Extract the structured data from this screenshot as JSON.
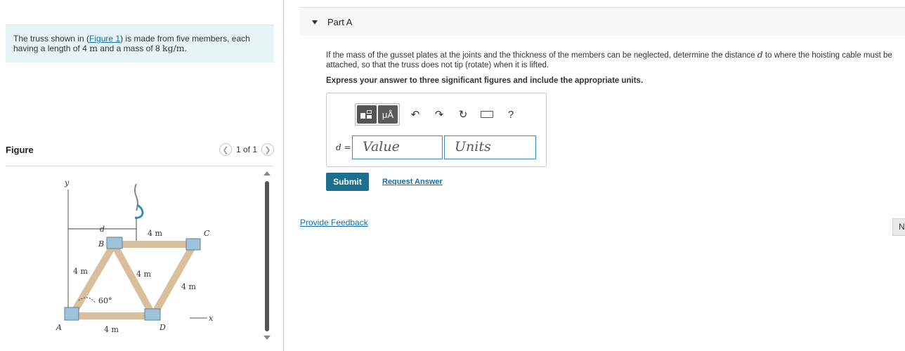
{
  "problem": {
    "text_before_link": "The truss shown in (",
    "link": "Figure 1",
    "text_after_link": ") is made from five members, each having a length of 4 ",
    "unit_m": "m",
    "text_mass": " and a mass of 8 ",
    "unit_kgm": "kg/m",
    "text_end": "."
  },
  "figure": {
    "title": "Figure",
    "pager": "1 of 1",
    "labels": {
      "y": "y",
      "d": "d",
      "b": "B",
      "c": "C",
      "a": "A",
      "dd": "D",
      "x": "x",
      "top_len": "4 m",
      "left_len": "4 m",
      "mid_len": "4 m",
      "right_len": "4 m",
      "bottom_len": "4 m",
      "angle": "60°"
    }
  },
  "part": {
    "title": "Part A",
    "question_pre": "If the mass of the gusset plates at the joints and the thickness of the members can be neglected, determine the distance ",
    "question_var": "d",
    "question_post": " to where the hoisting cable must be attached, so that the truss does not tip (rotate) when it is lifted.",
    "instruction": "Express your answer to three significant figures and include the appropriate units.",
    "toolbar": {
      "units_glyph": "μÅ",
      "help": "?"
    },
    "d_label": "d",
    "d_eq": " =",
    "value_placeholder": "Value",
    "units_placeholder": "Units",
    "submit": "Submit",
    "request_answer": "Request Answer"
  },
  "feedback": "Provide Feedback",
  "next": "N"
}
